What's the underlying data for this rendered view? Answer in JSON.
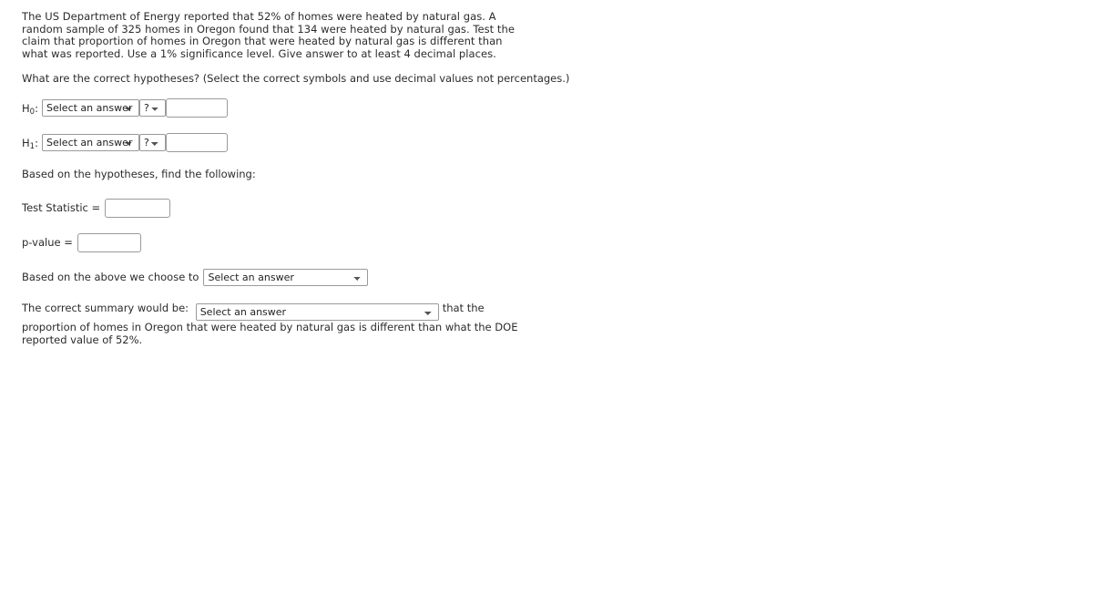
{
  "problem": {
    "statement": "The US Department of Energy reported that 52% of homes were heated by natural gas. A random sample of 325 homes in Oregon found that 134 were heated by natural gas. Test the claim that proportion of homes in Oregon that were heated by natural gas is different than what was reported. Use a 1% significance level. Give answer to at least 4 decimal places.",
    "reported_percent": "52%",
    "sample_size": "325",
    "successes": "134",
    "significance_level": "1%",
    "decimal_places": "4"
  },
  "hypotheses": {
    "question": "What are the correct hypotheses? (Select the correct symbols and use decimal values not percentages.)",
    "null": {
      "label": "H",
      "subscript": "0",
      "colon": ":",
      "parameter_select": "Select an answer",
      "operator_select": "?",
      "value_input": "",
      "value_placeholder": ""
    },
    "alternative": {
      "label": "H",
      "subscript": "1",
      "colon": ":",
      "parameter_select": "Select an answer",
      "operator_select": "?",
      "value_input": "",
      "value_placeholder": ""
    }
  },
  "findings": {
    "intro": "Based on the hypotheses, find the following:",
    "test_statistic_label": "Test Statistic =",
    "test_statistic_value": "",
    "p_value_label": "p-value =",
    "p_value_value": ""
  },
  "decision": {
    "label": "Based on the above we choose to",
    "select_value": "Select an answer"
  },
  "summary": {
    "label": "The correct summary would be:",
    "select_value": "Select an answer",
    "tail_text": "that the proportion of homes in Oregon that were heated by natural gas is different than what the DOE reported value of 52%."
  },
  "colors": {
    "text": "#2b2b2b",
    "control_border": "#9a9a9a",
    "background": "#ffffff"
  }
}
